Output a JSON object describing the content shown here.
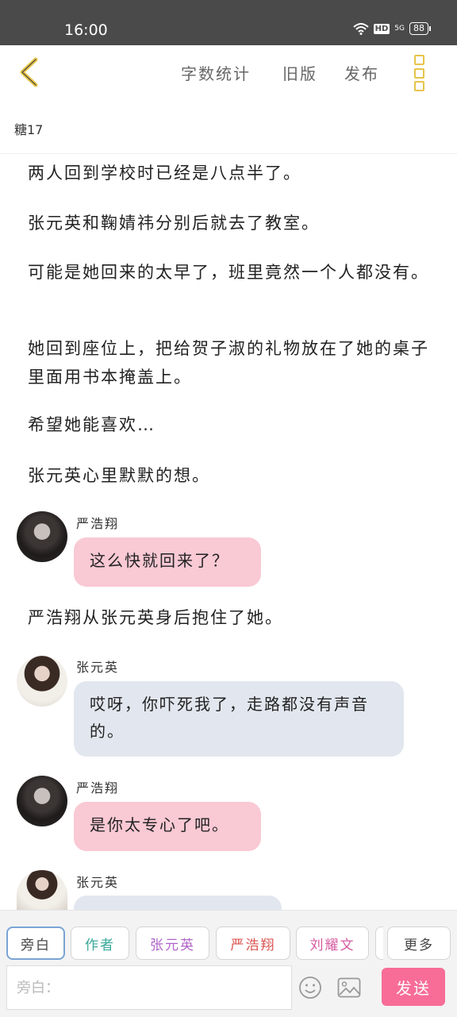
{
  "status": {
    "time": "16:00",
    "hd": "HD",
    "signal": "5G",
    "battery": "88"
  },
  "toolbar": {
    "word_count": "字数统计",
    "old_version": "旧版",
    "publish": "发布"
  },
  "chapter_title": "糖17",
  "paragraphs": [
    "两人回到学校时已经是八点半了。",
    "张元英和鞠婧祎分别后就去了教室。",
    "可能是她回来的太早了，班里竟然一个人都没有。",
    "她回到座位上，把给贺子淑的礼物放在了她的桌子里面用书本掩盖上。",
    "希望她能喜欢…",
    "张元英心里默默的想。",
    "严浩翔从张元英身后抱住了她。"
  ],
  "messages": [
    {
      "name": "严浩翔",
      "text": "这么快就回来了？"
    },
    {
      "name": "张元英",
      "text": "哎呀，你吓死我了，走路都没有声音的。"
    },
    {
      "name": "严浩翔",
      "text": "是你太专心了吧。"
    },
    {
      "name": "张元英",
      "text": ""
    }
  ],
  "characters": [
    {
      "label": "旁白",
      "color": "#444444"
    },
    {
      "label": "作者",
      "color": "#3aa89a"
    },
    {
      "label": "张元英",
      "color": "#b064c8"
    },
    {
      "label": "严浩翔",
      "color": "#d9534f"
    },
    {
      "label": "刘耀文",
      "color": "#d65aa0"
    },
    {
      "label": "更多",
      "color": "#444444"
    }
  ],
  "input": {
    "placeholder": "旁白："
  },
  "send_label": "发送",
  "colors": {
    "accent_yellow": "#e6c44a",
    "send_pink": "#f76d97",
    "bubble_pink": "#f9c9d4",
    "bubble_blue": "#e2e7ef"
  }
}
